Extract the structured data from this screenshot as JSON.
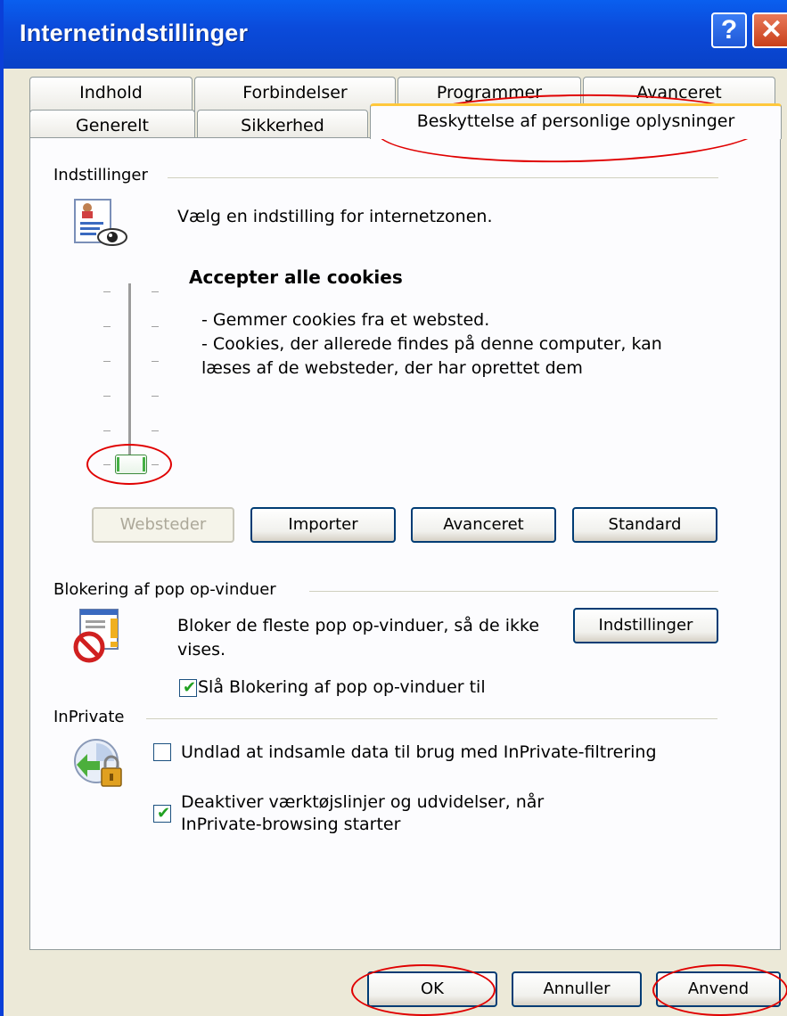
{
  "window": {
    "title": "Internetindstillinger"
  },
  "tabs": {
    "row_back": [
      "Indhold",
      "Forbindelser",
      "Programmer",
      "Avanceret"
    ],
    "row_front": [
      "Generelt",
      "Sikkerhed",
      "Beskyttelse af personlige oplysninger"
    ],
    "active": "Beskyttelse af personlige oplysninger"
  },
  "settings": {
    "group_label": "Indstillinger",
    "zone_prompt": "Vælg en indstilling for internetzonen.",
    "level_title": "Accepter alle cookies",
    "level_desc_1": "- Gemmer cookies fra et websted.",
    "level_desc_2": "- Cookies, der allerede findes på denne computer, kan",
    "level_desc_3": "læses af de websteder, der har oprettet dem",
    "slider_level": 0,
    "buttons": {
      "sites": "Websteder",
      "import": "Importer",
      "advanced": "Avanceret",
      "default": "Standard"
    }
  },
  "popup": {
    "group_label": "Blokering af pop op-vinduer",
    "desc_1": "Bloker de fleste pop op-vinduer, så de ikke",
    "desc_2": "vises.",
    "settings_button": "Indstillinger",
    "toggle_label": "Slå Blokering af pop op-vinduer til",
    "toggle_checked": true
  },
  "inprivate": {
    "group_label": "InPrivate",
    "filter_label": "Undlad at indsamle data til brug med InPrivate-filtrering",
    "filter_checked": false,
    "disable_label_1": "Deaktiver værktøjslinjer og udvidelser, når",
    "disable_label_2": "InPrivate-browsing starter",
    "disable_checked": true
  },
  "footer": {
    "ok": "OK",
    "cancel": "Annuller",
    "apply": "Anvend"
  },
  "icons": {
    "help": "?",
    "close": "✕",
    "check": "✔"
  },
  "colors": {
    "titlebar": "#0B4BDB",
    "annotation": "#E00000",
    "checkmark": "#21A121"
  }
}
